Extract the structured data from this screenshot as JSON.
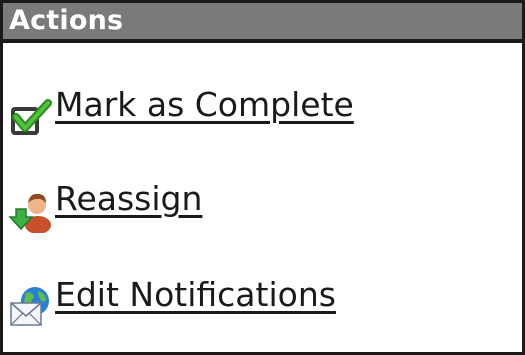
{
  "panel": {
    "title": "Actions"
  },
  "actions": [
    {
      "label": "Mark as Complete",
      "icon": "checkbox-check-icon"
    },
    {
      "label": "Reassign",
      "icon": "user-arrow-icon"
    },
    {
      "label": "Edit Notifications",
      "icon": "globe-envelope-icon"
    }
  ],
  "colors": {
    "header_bg": "#7a7a7a",
    "border": "#1a1a1a",
    "check_green": "#3aa52a",
    "arrow_green": "#3cb043",
    "globe_blue": "#2a7fd4"
  }
}
